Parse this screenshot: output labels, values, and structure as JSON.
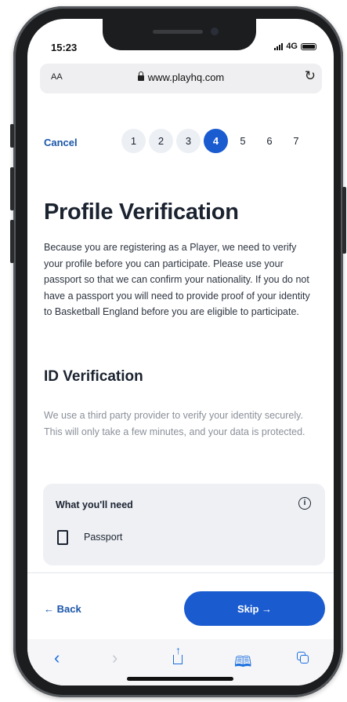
{
  "status_bar": {
    "time": "15:23",
    "network": "4G"
  },
  "browser": {
    "text_size_label": "AA",
    "url": "www.playhq.com",
    "reload_glyph": "↻"
  },
  "stepper": {
    "cancel_label": "Cancel",
    "steps": [
      "1",
      "2",
      "3",
      "4",
      "5",
      "6",
      "7"
    ],
    "current_step": 4
  },
  "page": {
    "title": "Profile Verification",
    "intro": "Because you are registering as a Player, we need to verify your profile before you can participate. Please use your passport so that we can confirm your nationality. If you do not have a passport you will need to provide proof of your identity to Basketball England before you are eligible to participate.",
    "id_heading": "ID Verification",
    "id_description": "We use a third party provider to verify your identity securely. This will only take a few minutes, and your data is protected."
  },
  "requirements_card": {
    "title": "What you'll need",
    "info_glyph": "i",
    "item": "Passport"
  },
  "footer": {
    "back_label": "← Back",
    "skip_label": "Skip →"
  },
  "toolbar": {
    "back_glyph": "‹",
    "forward_glyph": "›",
    "share_glyph": "↑",
    "bookmarks_glyph": "🕮"
  },
  "colors": {
    "accent": "#1a5bd0",
    "link": "#1a56a8",
    "card_bg": "#eef0f4"
  }
}
